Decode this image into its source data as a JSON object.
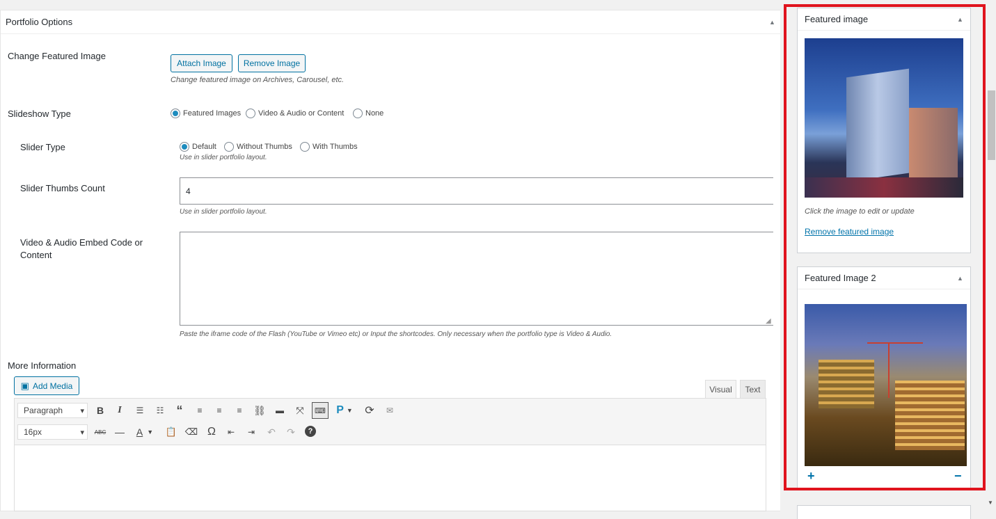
{
  "portfolio": {
    "title": "Portfolio Options",
    "change_featured_label": "Change Featured Image",
    "attach_btn": "Attach Image",
    "remove_btn": "Remove Image",
    "change_featured_desc": "Change featured image on Archives, Carousel, etc.",
    "slideshow_label": "Slideshow Type",
    "slideshow_options": [
      "Featured Images",
      "Video & Audio or Content",
      "None"
    ],
    "slideshow_selected": "Featured Images",
    "slider_type_label": "Slider Type",
    "slider_type_options": [
      "Default",
      "Without Thumbs",
      "With Thumbs"
    ],
    "slider_type_selected": "Default",
    "slider_type_desc": "Use in slider portfolio layout.",
    "thumbs_count_label": "Slider Thumbs Count",
    "thumbs_count_value": "4",
    "thumbs_count_desc": "Use in slider portfolio layout.",
    "embed_label_1": "Video & Audio Embed Code or",
    "embed_label_2": "Content",
    "embed_value": "",
    "embed_desc": "Paste the iframe code of the Flash (YouTube or Vimeo etc) or Input the shortcodes. Only necessary when the portfolio type is Video & Audio."
  },
  "more_info": {
    "title": "More Information",
    "add_media": "Add Media",
    "tab_visual": "Visual",
    "tab_text": "Text",
    "format_select": "Paragraph",
    "size_select": "16px"
  },
  "featured_image": {
    "title": "Featured image",
    "hint": "Click the image to edit or update",
    "remove_link": "Remove featured image"
  },
  "featured_image_2": {
    "title": "Featured Image 2"
  },
  "colors": {
    "accent": "#0071a1",
    "highlight_border": "#e0141e"
  }
}
